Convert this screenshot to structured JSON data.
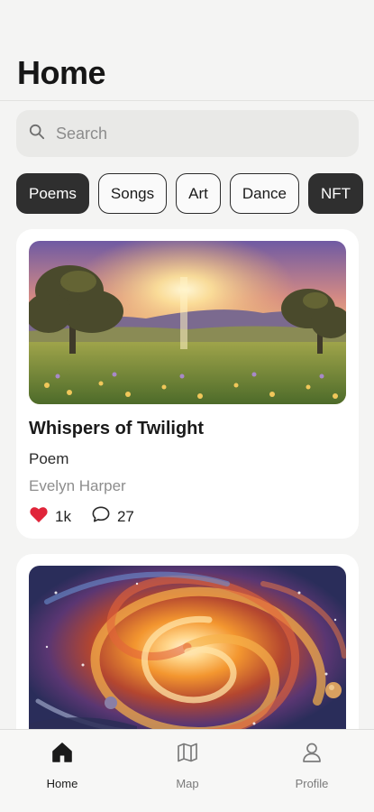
{
  "header": {
    "title": "Home"
  },
  "search": {
    "placeholder": "Search",
    "icon": "search-icon"
  },
  "categories": [
    {
      "label": "Poems",
      "active": true
    },
    {
      "label": "Songs",
      "active": false
    },
    {
      "label": "Art",
      "active": false
    },
    {
      "label": "Dance",
      "active": false
    },
    {
      "label": "NFT",
      "active": true
    }
  ],
  "feed": [
    {
      "title": "Whispers of Twilight",
      "type": "Poem",
      "author": "Evelyn Harper",
      "likes": "1k",
      "comments": "27",
      "image": "sunset-meadow-painting"
    },
    {
      "image": "galaxy-swirl-painting"
    }
  ],
  "tabbar": {
    "tabs": [
      {
        "label": "Home",
        "icon": "home-icon",
        "active": true
      },
      {
        "label": "Map",
        "icon": "map-icon",
        "active": false
      },
      {
        "label": "Profile",
        "icon": "profile-icon",
        "active": false
      }
    ]
  },
  "colors": {
    "accent": "#2f2f2f",
    "heart": "#e0253a",
    "background": "#f4f4f3"
  }
}
